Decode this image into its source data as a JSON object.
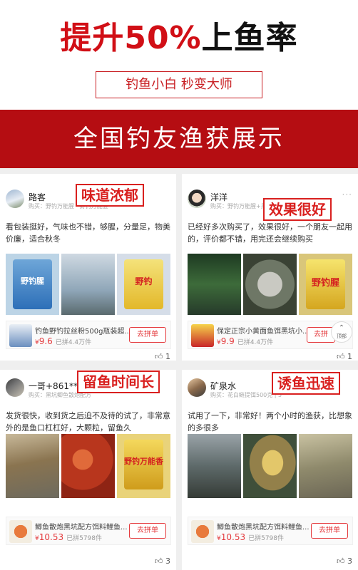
{
  "hero": {
    "title_accent_1": "提升",
    "title_accent_2": "50%",
    "title_dark": "上鱼率"
  },
  "tagline": "钓鱼小白 秒变大师",
  "banner": {
    "text": "全国钓友渔获展示"
  },
  "colors": {
    "accent": "#d10f16",
    "banner_bg": "#b50d12",
    "price": "#e4393c"
  },
  "cards": [
    {
      "user": "路客",
      "buy_line": "购买：野钓万能腥 · 野钓万能腥",
      "badge": "味道浓郁",
      "review": "看包装挺好，气味也不错，够腥，分量足，物美价廉，适合秋冬",
      "photos": [
        {
          "label": "野钓腥"
        },
        {
          "label": ""
        },
        {
          "label": "野钓"
        }
      ],
      "product_name": "钓鱼野钓拉丝粉500g瓶装超...",
      "price": "9.6",
      "currency": "¥",
      "sold": "已拼4.4万件",
      "buy_label": "去拼单",
      "likes": "1",
      "like_icon": "thumbs-up-icon"
    },
    {
      "user": "洋洋",
      "buy_line": "购买：野钓万能腥+黑坑",
      "badge": "效果很好",
      "review": "已经好多次购买了，效果很好，一个朋友一起用的，评价都不错，用完还会继续购买",
      "photos": [
        {
          "label": ""
        },
        {
          "label": ""
        },
        {
          "label": "野钓腥"
        }
      ],
      "product_name": "保定正宗小黄面鱼饵黑坑小...",
      "price": "9.9",
      "currency": "¥",
      "sold": "已拼4.4万件",
      "buy_label": "去拼",
      "likes": "1",
      "like_icon": "thumbs-up-icon",
      "top_label": "顶部"
    },
    {
      "user": "一哥+861****9",
      "buy_line": "购买：黑坑鲫鱼散炮配方",
      "badge": "留鱼时间长",
      "review": "发货很快，收到货之后迫不及待的试了，非常意外的是鱼口杠杠好，大颗粒，留鱼久",
      "photos": [
        {
          "label": ""
        },
        {
          "label": ""
        },
        {
          "label": "野钓万能香"
        }
      ],
      "product_name": "鲫鱼散炮黑坑配方饵料鲤鱼...",
      "price": "10.53",
      "currency": "¥",
      "sold": "已拼5798件",
      "buy_label": "去拼单",
      "likes": "3",
      "like_icon": "thumbs-up-icon"
    },
    {
      "user": "矿泉水",
      "buy_line": "购买：花白鲢提饵500克 | 5",
      "badge": "诱鱼迅速",
      "review": "试用了一下，非常好！两个小时的渔获，比想象的多很多",
      "photos": [
        {
          "label": ""
        },
        {
          "label": ""
        },
        {
          "label": ""
        }
      ],
      "product_name": "鲫鱼散炮黑坑配方饵料鲤鱼...",
      "price": "10.53",
      "currency": "¥",
      "sold": "已拼5798件",
      "buy_label": "去拼单",
      "likes": "3",
      "like_icon": "thumbs-up-icon"
    }
  ]
}
